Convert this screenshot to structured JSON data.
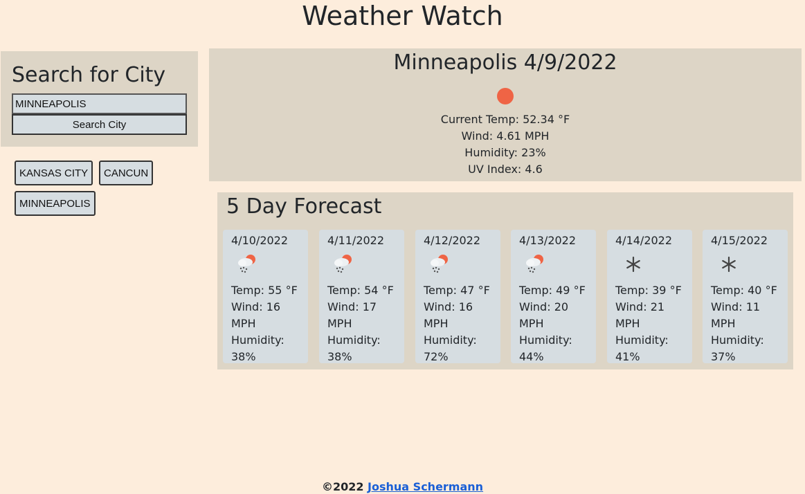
{
  "app": {
    "title": "Weather Watch"
  },
  "search": {
    "heading": "Search for City",
    "input_value": "MINNEAPOLIS",
    "button_label": "Search City"
  },
  "history": [
    "KANSAS CITY",
    "CANCUN",
    "MINNEAPOLIS"
  ],
  "current": {
    "title": "Minneapolis 4/9/2022",
    "icon": "sun-icon",
    "temp": "Current Temp: 52.34 °F",
    "wind": "Wind: 4.61 MPH",
    "humidity": "Humidity: 23%",
    "uv": "UV Index: 4.6"
  },
  "forecast": {
    "heading": "5 Day Forecast",
    "days": [
      {
        "date": "4/10/2022",
        "icon": "snow-showers-icon",
        "temp": "Temp: 55 °F",
        "wind1": "Wind: 16",
        "wind2": "MPH",
        "hum1": "Humidity:",
        "hum2": "38%"
      },
      {
        "date": "4/11/2022",
        "icon": "snow-showers-icon",
        "temp": "Temp: 54 °F",
        "wind1": "Wind: 17",
        "wind2": "MPH",
        "hum1": "Humidity:",
        "hum2": "38%"
      },
      {
        "date": "4/12/2022",
        "icon": "snow-showers-icon",
        "temp": "Temp: 47 °F",
        "wind1": "Wind: 16",
        "wind2": "MPH",
        "hum1": "Humidity:",
        "hum2": "72%"
      },
      {
        "date": "4/13/2022",
        "icon": "snow-showers-icon",
        "temp": "Temp: 49 °F",
        "wind1": "Wind: 20",
        "wind2": "MPH",
        "hum1": "Humidity:",
        "hum2": "44%"
      },
      {
        "date": "4/14/2022",
        "icon": "snowflake-icon",
        "temp": "Temp: 39 °F",
        "wind1": "Wind: 21",
        "wind2": "MPH",
        "hum1": "Humidity:",
        "hum2": "41%"
      },
      {
        "date": "4/15/2022",
        "icon": "snowflake-icon",
        "temp": "Temp: 40 °F",
        "wind1": "Wind: 11",
        "wind2": "MPH",
        "hum1": "Humidity:",
        "hum2": "37%"
      }
    ]
  },
  "footer": {
    "copyright": "©2022",
    "author": "Joshua Schermann"
  },
  "colors": {
    "background": "#fdeddc",
    "panel": "#ddd5c6",
    "card": "#d6dde1",
    "sun": "#ef6445",
    "link": "#1a5fd6"
  }
}
